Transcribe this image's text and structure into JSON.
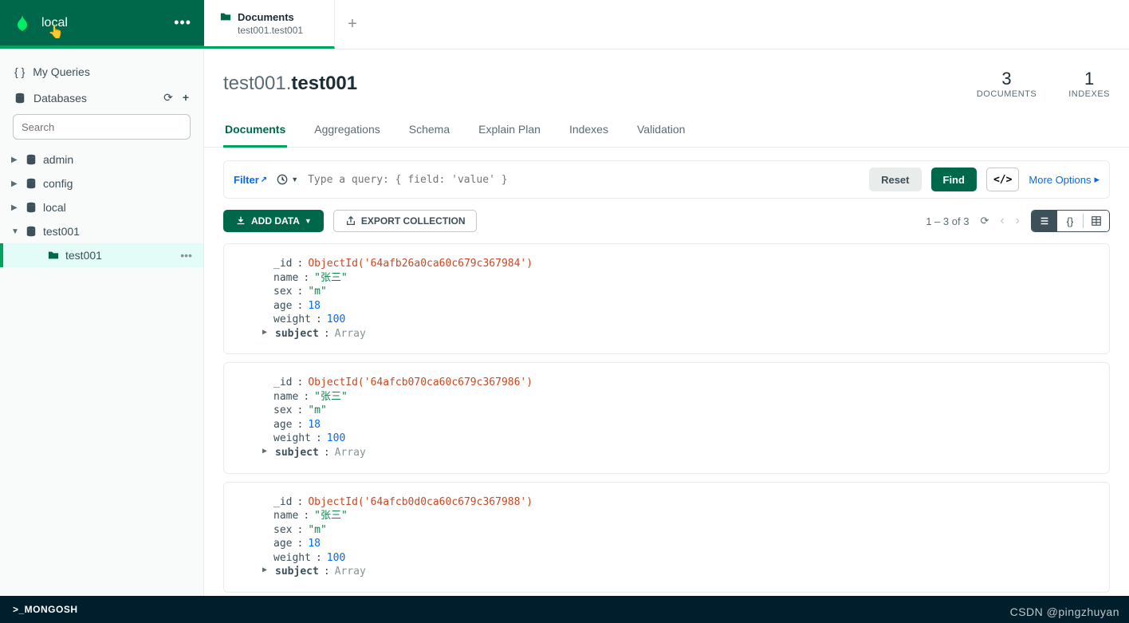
{
  "brand": {
    "name": "local"
  },
  "tab": {
    "title": "Documents",
    "subtitle": "test001.test001"
  },
  "sidebar": {
    "myQueries": "My Queries",
    "databasesLabel": "Databases",
    "searchPlaceholder": "Search",
    "dbs": [
      "admin",
      "config",
      "local",
      "test001"
    ],
    "collection": "test001"
  },
  "collection": {
    "db": "test001",
    "name": "test001"
  },
  "stats": {
    "documentsCount": "3",
    "documentsLabel": "DOCUMENTS",
    "indexesCount": "1",
    "indexesLabel": "INDEXES"
  },
  "subtabs": [
    "Documents",
    "Aggregations",
    "Schema",
    "Explain Plan",
    "Indexes",
    "Validation"
  ],
  "filter": {
    "label": "Filter",
    "placeholder": "Type a query: { field: 'value' }",
    "reset": "Reset",
    "find": "Find",
    "more": "More Options"
  },
  "toolbar": {
    "addData": "ADD DATA",
    "export": "EXPORT COLLECTION",
    "pageInfo": "1 – 3 of 3"
  },
  "fieldLabels": {
    "id": "_id",
    "name": "name",
    "sex": "sex",
    "age": "age",
    "weight": "weight",
    "subject": "subject",
    "arrayType": "Array"
  },
  "docs": [
    {
      "id": "ObjectId('64afb26a0ca60c679c367984')",
      "name": "\"张三\"",
      "sex": "\"m\"",
      "age": "18",
      "weight": "100"
    },
    {
      "id": "ObjectId('64afcb070ca60c679c367986')",
      "name": "\"张三\"",
      "sex": "\"m\"",
      "age": "18",
      "weight": "100"
    },
    {
      "id": "ObjectId('64afcb0d0ca60c679c367988')",
      "name": "\"张三\"",
      "sex": "\"m\"",
      "age": "18",
      "weight": "100"
    }
  ],
  "footer": {
    "shell": ">_MONGOSH"
  },
  "watermark": "CSDN @pingzhuyan"
}
